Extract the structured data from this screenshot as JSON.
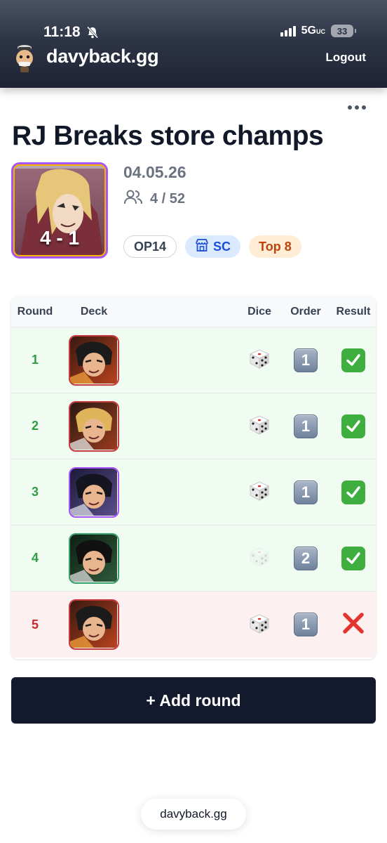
{
  "status_bar": {
    "time": "11:18",
    "network": "5G",
    "network_suffix": "UC",
    "battery": "33"
  },
  "header": {
    "brand": "davyback.gg",
    "logout_label": "Logout"
  },
  "event": {
    "title": "RJ Breaks store champs",
    "record": "4 - 1",
    "date": "04.05.26",
    "players": "4 / 52",
    "badges": {
      "set": "OP14",
      "store": "SC",
      "placement": "Top 8"
    }
  },
  "table": {
    "headers": {
      "round": "Round",
      "deck": "Deck",
      "dice": "Dice",
      "order": "Order",
      "result": "Result"
    },
    "rows": [
      {
        "round": "1",
        "dice_won": true,
        "order": "1",
        "result": "win"
      },
      {
        "round": "2",
        "dice_won": true,
        "order": "1",
        "result": "win"
      },
      {
        "round": "3",
        "dice_won": true,
        "order": "1",
        "result": "win"
      },
      {
        "round": "4",
        "dice_won": false,
        "order": "2",
        "result": "win"
      },
      {
        "round": "5",
        "dice_won": true,
        "order": "1",
        "result": "loss"
      }
    ]
  },
  "actions": {
    "add_round": "+ Add round"
  },
  "browser": {
    "url": "davyback.gg"
  },
  "colors": {
    "win_row": "#f0fbf1",
    "loss_row": "#fdf0f0",
    "win_text": "#2f9e44",
    "loss_text": "#c92a2a",
    "button": "#141a2e"
  }
}
